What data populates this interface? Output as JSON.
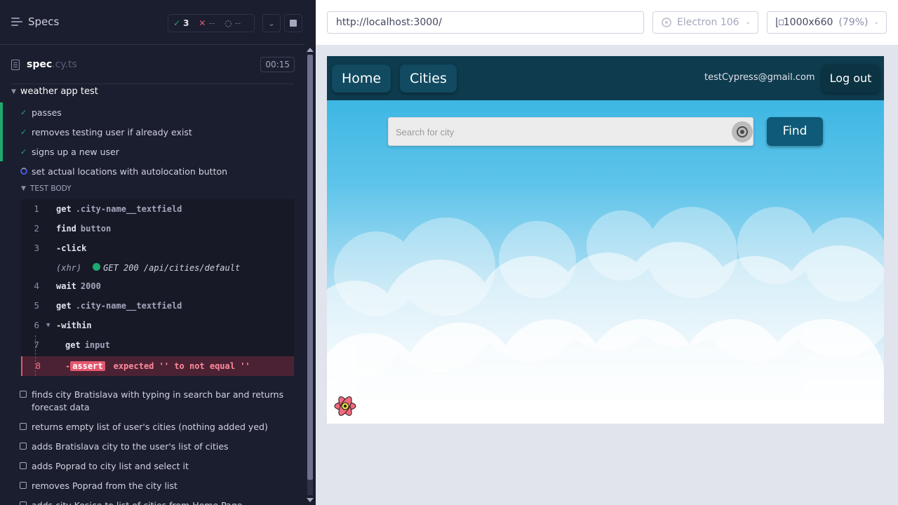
{
  "reporter": {
    "header": {
      "title": "Specs",
      "passed": "3",
      "failed": "--",
      "pending": "--"
    },
    "file": {
      "name": "spec",
      "ext": ".cy.ts",
      "duration": "00:15"
    },
    "suite": "weather app test",
    "tests_done": [
      {
        "label": "passes",
        "state": "passed"
      },
      {
        "label": "removes testing user if already exist",
        "state": "passed"
      },
      {
        "label": "signs up a new user",
        "state": "passed"
      },
      {
        "label": "set actual locations with autolocation button",
        "state": "running"
      }
    ],
    "test_body_label": "TEST BODY",
    "commands": [
      {
        "n": "1",
        "name": "get",
        "msg": ".city-name__textfield"
      },
      {
        "n": "2",
        "name": "find",
        "msg": "button"
      },
      {
        "n": "3",
        "name": "-click",
        "msg": ""
      },
      {
        "n": "",
        "name": "(xhr)",
        "msg": "GET 200 /api/cities/default"
      },
      {
        "n": "4",
        "name": "wait",
        "msg": "2000"
      },
      {
        "n": "5",
        "name": "get",
        "msg": ".city-name__textfield"
      },
      {
        "n": "6",
        "name": "-within",
        "msg": ""
      },
      {
        "n": "7",
        "name": "get",
        "msg": "input"
      },
      {
        "n": "8",
        "name": "-",
        "badge": "assert",
        "msg": "expected '' to not equal ''"
      }
    ],
    "pending_tests": [
      "finds city Bratislava with typing in search bar and returns forecast data",
      "returns empty list of user's cities (nothing added yed)",
      "adds Bratislava city to the user's list of cities",
      "adds Poprad to city list and select it",
      "removes Poprad from the city list",
      "adds city Kosice to list of cities from Home Page"
    ]
  },
  "topbar": {
    "url": "http://localhost:3000/",
    "browser": "Electron 106",
    "viewport": "1000x660",
    "zoom": "(79%)"
  },
  "app": {
    "nav": {
      "home": "Home",
      "cities": "Cities",
      "email": "testCypress@gmail.com",
      "logout": "Log out"
    },
    "search": {
      "placeholder": "Search for city",
      "value": ""
    },
    "find_label": "Find"
  },
  "colors": {
    "reporter_bg": "#1b1e2e",
    "pass": "#1fa971",
    "fail": "#e45770",
    "app_nav": "#0e3b4d",
    "find_btn": "#0f5a78"
  }
}
